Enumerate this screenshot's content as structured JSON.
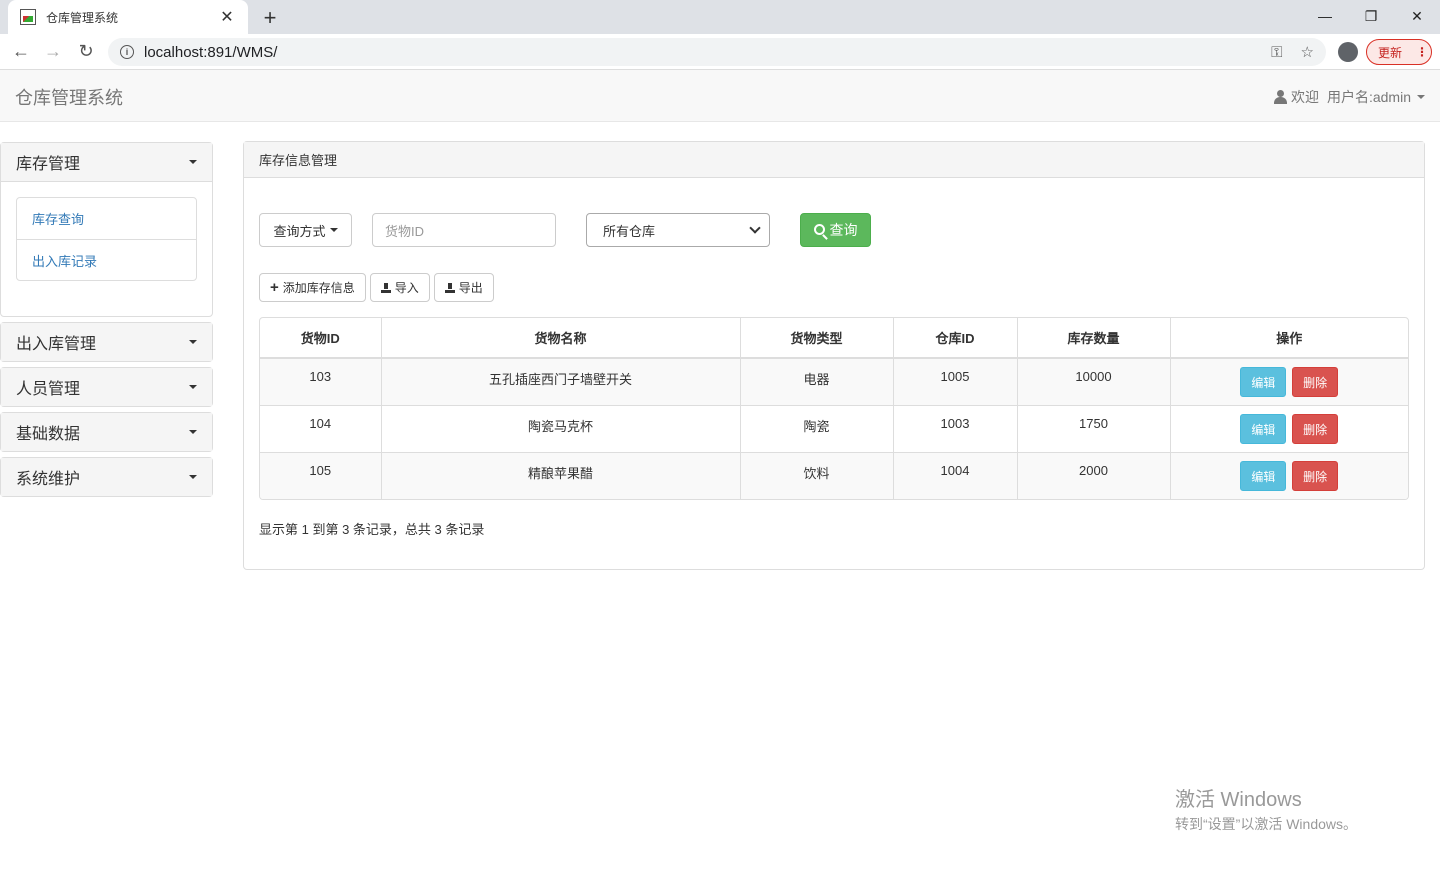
{
  "browser": {
    "tab_title": "仓库管理系统",
    "tab_close": "✕",
    "new_tab": "+",
    "window_buttons": [
      "—",
      "❐",
      "✕"
    ],
    "url": "localhost:891/WMS/",
    "update_label": "更新",
    "nav_icons": [
      "back-icon",
      "forward-icon",
      "reload-icon"
    ],
    "nav_glyphs": [
      "←",
      "→",
      "↻"
    ],
    "omnibox_glyphs": [
      "⚿",
      "☆"
    ]
  },
  "app": {
    "brand": "仓库管理系统",
    "welcome": "欢迎",
    "username": "用户名:admin"
  },
  "sidebar": {
    "groups": [
      {
        "label": "库存管理",
        "items": [
          "库存查询",
          "出入库记录"
        ]
      },
      {
        "label": "出入库管理"
      },
      {
        "label": "人员管理"
      },
      {
        "label": "基础数据"
      },
      {
        "label": "系统维护"
      }
    ]
  },
  "main": {
    "title": "库存信息管理",
    "query_mode_label": "查询方式",
    "search_placeholder": "货物ID",
    "warehouse_select": "所有仓库",
    "search_button": "查询",
    "add_button": "添加库存信息",
    "import_button": "导入",
    "export_button": "导出",
    "table": {
      "columns": [
        "货物ID",
        "货物名称",
        "货物类型",
        "仓库ID",
        "库存数量",
        "操作"
      ],
      "rows": [
        [
          "103",
          "五孔插座西门子墙壁开关",
          "电器",
          "1005",
          "10000"
        ],
        [
          "104",
          "陶瓷马克杯",
          "陶瓷",
          "1003",
          "1750"
        ],
        [
          "105",
          "精酿苹果醋",
          "饮料",
          "1004",
          "2000"
        ]
      ],
      "edit_label": "编辑",
      "delete_label": "删除"
    },
    "summary": "显示第 1 到第 3 条记录，总共 3 条记录"
  },
  "watermark": {
    "line1": "激活 Windows",
    "line2": "转到“设置”以激活 Windows。"
  },
  "colors": {
    "success": "#5cb85c",
    "info": "#5bc0de",
    "danger": "#d9534f",
    "link": "#337ab7"
  }
}
